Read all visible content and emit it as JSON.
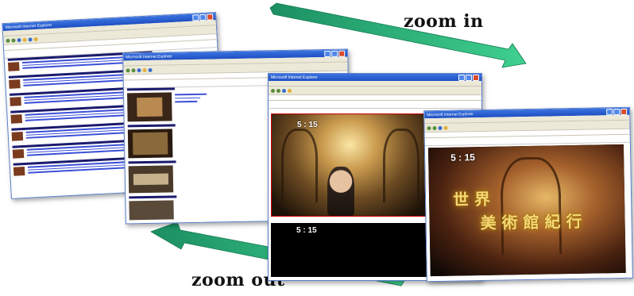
{
  "labels": {
    "zoom_in": "zoom in",
    "zoom_out": "zoom out"
  },
  "windows": [
    {
      "title": "Microsoft Internet Explorer"
    },
    {
      "title": "Microsoft Internet Explorer"
    },
    {
      "title": "Microsoft Internet Explorer"
    },
    {
      "title": "Microsoft Internet Explorer"
    }
  ],
  "video": {
    "timecode": "5 : 15",
    "title_line1": "世 界",
    "title_line2": "美 術 館 紀 行"
  },
  "colors": {
    "arrow": "#2bb07a",
    "titlebar": "#1e4fc2",
    "link": "#3b4fd8"
  }
}
